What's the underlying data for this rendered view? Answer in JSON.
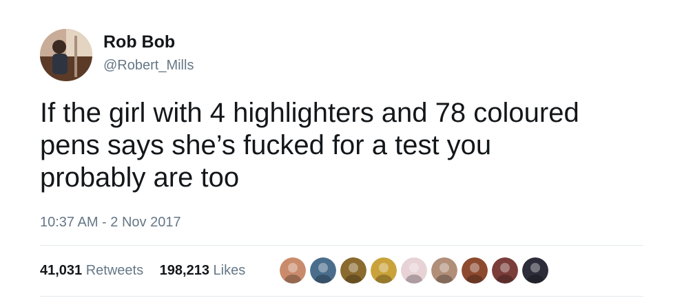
{
  "author": {
    "display_name": "Rob Bob",
    "handle": "@Robert_Mills",
    "avatar_icon": "profile-photo-icon"
  },
  "tweet": {
    "text_lines": [
      "If the girl with 4 highlighters and 78 coloured",
      "pens says she’s fucked for a test you",
      "probably are too"
    ],
    "timestamp": "10:37 AM - 2 Nov 2017"
  },
  "stats": {
    "retweets_count": "41,031",
    "retweets_label": "Retweets",
    "likes_count": "198,213",
    "likes_label": "Likes"
  },
  "likers": [
    {
      "icon": "liker-avatar-icon",
      "color": "#c98b6b"
    },
    {
      "icon": "liker-avatar-icon",
      "color": "#4a6d8c"
    },
    {
      "icon": "liker-avatar-icon",
      "color": "#8a6a2e"
    },
    {
      "icon": "liker-avatar-icon",
      "color": "#c9a23a"
    },
    {
      "icon": "liker-avatar-icon",
      "color": "#e7d2d6"
    },
    {
      "icon": "liker-avatar-icon",
      "color": "#b08e78"
    },
    {
      "icon": "liker-avatar-icon",
      "color": "#8d4a2f"
    },
    {
      "icon": "liker-avatar-icon",
      "color": "#7a3d3a"
    },
    {
      "icon": "liker-avatar-icon",
      "color": "#2c2c3a"
    }
  ],
  "colors": {
    "text_primary": "#14171a",
    "text_secondary": "#657786",
    "divider": "#e1e8ed"
  }
}
